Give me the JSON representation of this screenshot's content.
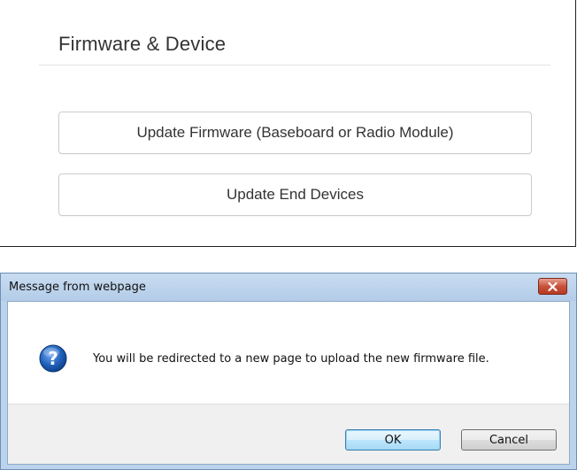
{
  "panel": {
    "title": "Firmware & Device",
    "buttons": [
      {
        "label": "Update Firmware (Baseboard or Radio Module)"
      },
      {
        "label": "Update End Devices"
      }
    ]
  },
  "dialog": {
    "title": "Message from webpage",
    "close_icon": "close-icon",
    "message_icon": "question-icon",
    "message": "You will be redirected to a new page to upload the new firmware file.",
    "ok_label": "OK",
    "cancel_label": "Cancel"
  },
  "colors": {
    "title_bar": "#bcd3ec",
    "close_button": "#c7523c",
    "question_icon": "#1f5fb8"
  }
}
